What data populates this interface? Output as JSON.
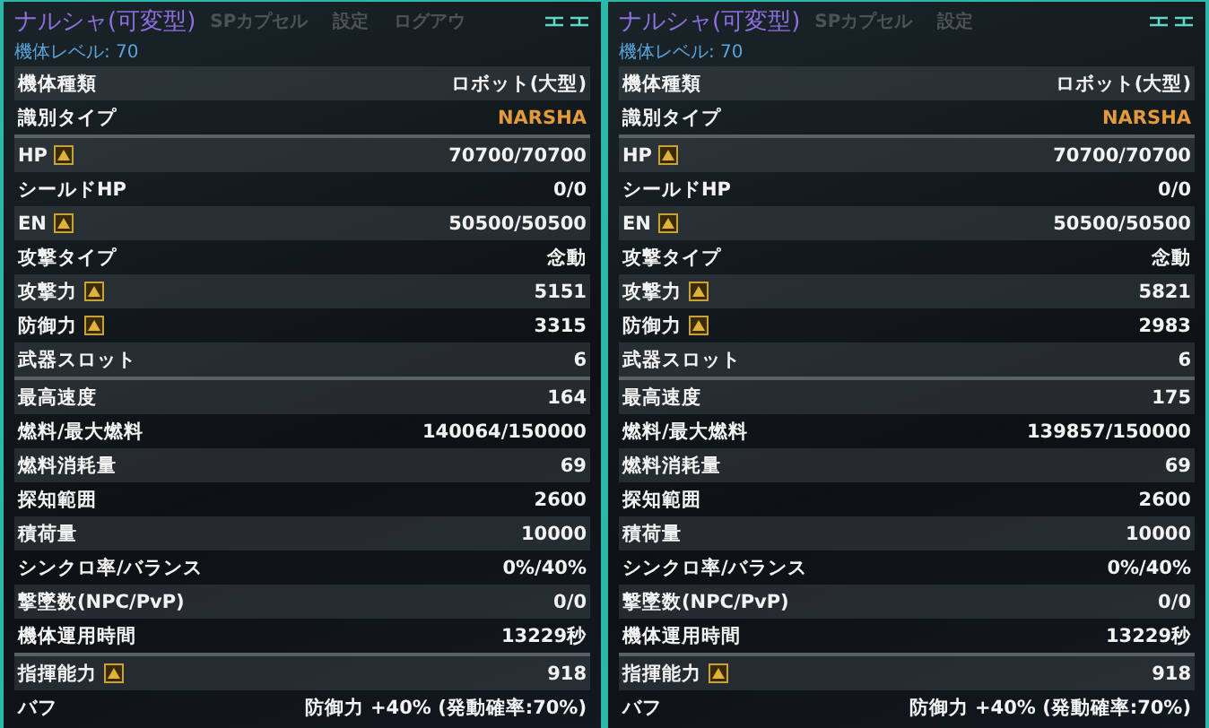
{
  "panels": [
    {
      "title": "ナルシャ(可変型)",
      "background_tabs": [
        "SPカプセル",
        "設定",
        "ログアウ"
      ],
      "level": "機体レベル: 70",
      "groups": [
        [
          {
            "label": "機体種類",
            "value": "ロボット(大型)",
            "boost": false,
            "highlight": false
          },
          {
            "label": "識別タイプ",
            "value": "NARSHA",
            "boost": false,
            "highlight": true
          }
        ],
        [
          {
            "label": "HP",
            "value": "70700/70700",
            "boost": true,
            "highlight": false
          },
          {
            "label": "シールドHP",
            "value": "0/0",
            "boost": false,
            "highlight": false
          },
          {
            "label": "EN",
            "value": "50500/50500",
            "boost": true,
            "highlight": false
          },
          {
            "label": "攻撃タイプ",
            "value": "念動",
            "boost": false,
            "highlight": false
          },
          {
            "label": "攻撃力",
            "value": "5151",
            "boost": true,
            "highlight": false
          },
          {
            "label": "防御力",
            "value": "3315",
            "boost": true,
            "highlight": false
          },
          {
            "label": "武器スロット",
            "value": "6",
            "boost": false,
            "highlight": false
          }
        ],
        [
          {
            "label": "最高速度",
            "value": "164",
            "boost": false,
            "highlight": false
          },
          {
            "label": "燃料/最大燃料",
            "value": "140064/150000",
            "boost": false,
            "highlight": false
          },
          {
            "label": "燃料消耗量",
            "value": "69",
            "boost": false,
            "highlight": false
          },
          {
            "label": "探知範囲",
            "value": "2600",
            "boost": false,
            "highlight": false
          },
          {
            "label": "積荷量",
            "value": "10000",
            "boost": false,
            "highlight": false
          },
          {
            "label": "シンクロ率/バランス",
            "value": "0%/40%",
            "boost": false,
            "highlight": false
          },
          {
            "label": "撃墜数(NPC/PvP)",
            "value": "0/0",
            "boost": false,
            "highlight": false
          },
          {
            "label": "機体運用時間",
            "value": "13229秒",
            "boost": false,
            "highlight": false
          }
        ],
        [
          {
            "label": "指揮能力",
            "value": "918",
            "boost": true,
            "highlight": false
          },
          {
            "label": "バフ",
            "value": "防御力 +40% (発動確率:70%)",
            "boost": false,
            "highlight": false
          }
        ]
      ]
    },
    {
      "title": "ナルシャ(可変型)",
      "background_tabs": [
        "SPカプセル",
        "設定"
      ],
      "level": "機体レベル: 70",
      "groups": [
        [
          {
            "label": "機体種類",
            "value": "ロボット(大型)",
            "boost": false,
            "highlight": false
          },
          {
            "label": "識別タイプ",
            "value": "NARSHA",
            "boost": false,
            "highlight": true
          }
        ],
        [
          {
            "label": "HP",
            "value": "70700/70700",
            "boost": true,
            "highlight": false
          },
          {
            "label": "シールドHP",
            "value": "0/0",
            "boost": false,
            "highlight": false
          },
          {
            "label": "EN",
            "value": "50500/50500",
            "boost": true,
            "highlight": false
          },
          {
            "label": "攻撃タイプ",
            "value": "念動",
            "boost": false,
            "highlight": false
          },
          {
            "label": "攻撃力",
            "value": "5821",
            "boost": true,
            "highlight": false
          },
          {
            "label": "防御力",
            "value": "2983",
            "boost": true,
            "highlight": false
          },
          {
            "label": "武器スロット",
            "value": "6",
            "boost": false,
            "highlight": false
          }
        ],
        [
          {
            "label": "最高速度",
            "value": "175",
            "boost": false,
            "highlight": false
          },
          {
            "label": "燃料/最大燃料",
            "value": "139857/150000",
            "boost": false,
            "highlight": false
          },
          {
            "label": "燃料消耗量",
            "value": "69",
            "boost": false,
            "highlight": false
          },
          {
            "label": "探知範囲",
            "value": "2600",
            "boost": false,
            "highlight": false
          },
          {
            "label": "積荷量",
            "value": "10000",
            "boost": false,
            "highlight": false
          },
          {
            "label": "シンクロ率/バランス",
            "value": "0%/40%",
            "boost": false,
            "highlight": false
          },
          {
            "label": "撃墜数(NPC/PvP)",
            "value": "0/0",
            "boost": false,
            "highlight": false
          },
          {
            "label": "機体運用時間",
            "value": "13229秒",
            "boost": false,
            "highlight": false
          }
        ],
        [
          {
            "label": "指揮能力",
            "value": "918",
            "boost": true,
            "highlight": false
          },
          {
            "label": "バフ",
            "value": "防御力 +40% (発動確率:70%)",
            "boost": false,
            "highlight": false
          }
        ]
      ]
    }
  ]
}
